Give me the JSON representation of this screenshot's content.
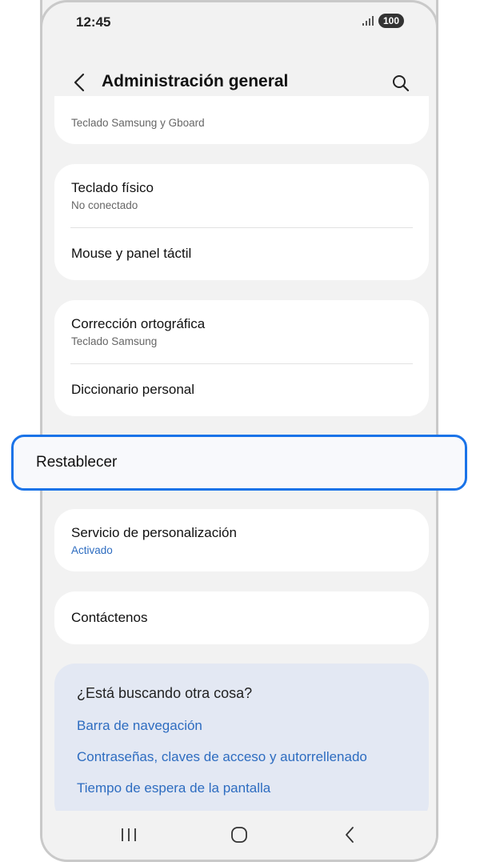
{
  "status": {
    "time": "12:45",
    "battery": "100"
  },
  "header": {
    "title": "Administración general"
  },
  "cards": {
    "keyboard_list_partial": {
      "subtitle": "Teclado Samsung y Gboard"
    },
    "physical": {
      "item1_title": "Teclado físico",
      "item1_sub": "No conectado",
      "item2_title": "Mouse y panel táctil"
    },
    "spelling": {
      "item1_title": "Corrección ortográfica",
      "item1_sub": "Teclado Samsung",
      "item2_title": "Diccionario personal"
    },
    "reset": {
      "title": "Restablecer"
    },
    "customization": {
      "title": "Servicio de personalización",
      "sub": "Activado"
    },
    "contact": {
      "title": "Contáctenos"
    }
  },
  "suggestions": {
    "title": "¿Está buscando otra cosa?",
    "links": [
      "Barra de navegación",
      "Contraseñas, claves de acceso y autorrellenado",
      "Tiempo de espera de la pantalla"
    ]
  },
  "colors": {
    "accent": "#1a73e8",
    "link": "#2d6cc0",
    "background": "#f2f2f2",
    "card": "#ffffff",
    "suggest_bg": "#e3e8f3"
  },
  "icons": {
    "back": "chevron-left-icon",
    "search": "search-icon",
    "recents": "recents-icon",
    "home": "home-icon",
    "nav_back": "back-icon"
  }
}
